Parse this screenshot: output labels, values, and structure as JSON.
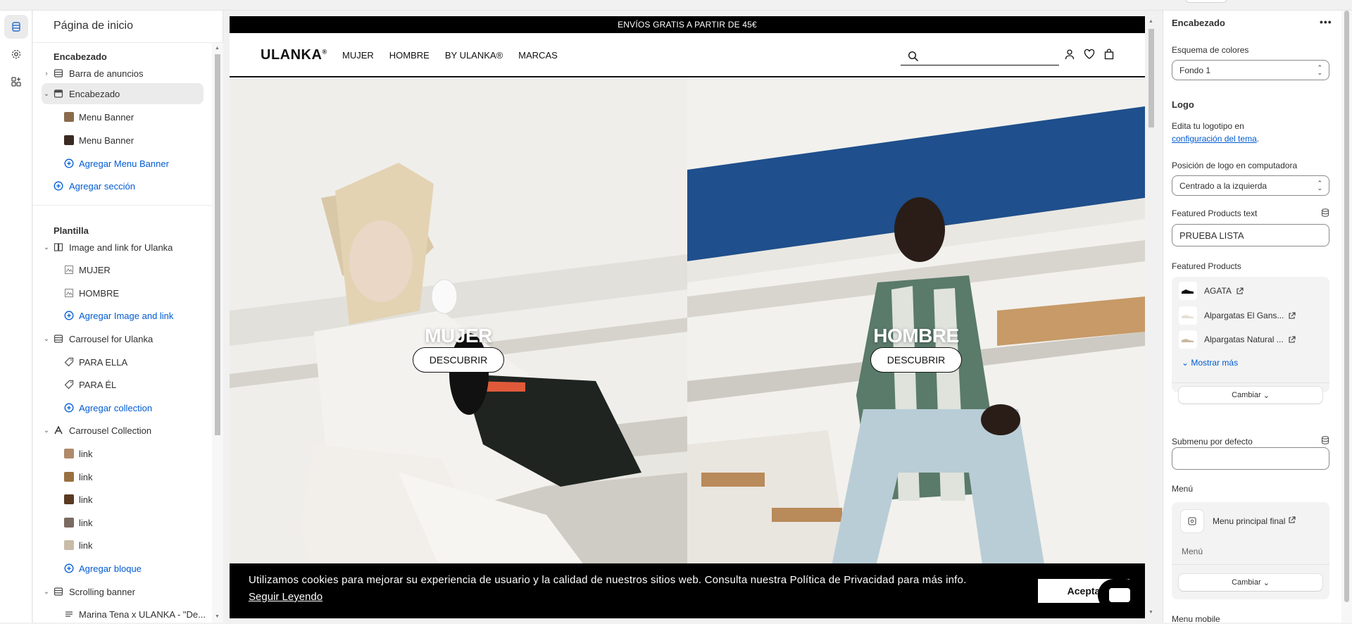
{
  "left_panel": {
    "title": "Página de inicio",
    "header_section": "Encabezado",
    "items": [
      {
        "label": "Barra de anuncios"
      },
      {
        "label": "Encabezado"
      },
      {
        "label": "Menu Banner"
      },
      {
        "label": "Menu Banner"
      },
      {
        "label": "Agregar Menu Banner"
      },
      {
        "label": "Agregar sección"
      }
    ],
    "template_section": "Plantilla",
    "template_items": [
      {
        "label": "Image and link for Ulanka"
      },
      {
        "label": "MUJER"
      },
      {
        "label": "HOMBRE"
      },
      {
        "label": "Agregar Image and link"
      },
      {
        "label": "Carrousel for Ulanka"
      },
      {
        "label": "PARA ELLA"
      },
      {
        "label": "PARA ÉL"
      },
      {
        "label": "Agregar collection"
      },
      {
        "label": "Carrousel Collection"
      },
      {
        "label": "link"
      },
      {
        "label": "link"
      },
      {
        "label": "link"
      },
      {
        "label": "link"
      },
      {
        "label": "link"
      },
      {
        "label": "Agregar bloque"
      },
      {
        "label": "Scrolling banner"
      },
      {
        "label": "Marina Tena x ULANKA - \"De..."
      }
    ]
  },
  "preview": {
    "announcement": "ENVÍOS GRATIS A PARTIR DE 45€",
    "logo": "ULANKA",
    "logo_mark": "®",
    "nav": [
      "MUJER",
      "HOMBRE",
      "BY ULANKA®",
      "MARCAS"
    ],
    "hero": [
      {
        "title": "MUJER",
        "button": "DESCUBRIR"
      },
      {
        "title": "HOMBRE",
        "button": "DESCUBRIR"
      }
    ],
    "cookie": {
      "message": "Utilizamos cookies para mejorar su experiencia de usuario y la calidad de nuestros sitios web. Consulta nuestra Política de Privacidad para más info.",
      "more_link": "Seguir Leyendo",
      "accept": "Acepta"
    }
  },
  "right_panel": {
    "title": "Encabezado",
    "more": "•••",
    "color_scheme_label": "Esquema de colores",
    "color_scheme_value": "Fondo 1",
    "logo_heading": "Logo",
    "logo_help_pre": "Edita tu logotipo en",
    "logo_help_link": "configuración del tema",
    "logo_help_post": ".",
    "logo_position_label": "Posición de logo en computadora",
    "logo_position_value": "Centrado a la izquierda",
    "featured_text_label": "Featured Products text",
    "featured_text_value": "PRUEBA LISTA",
    "featured_products_label": "Featured Products",
    "products": [
      "AGATA",
      "Alpargatas El Gans...",
      "Alpargatas Natural ..."
    ],
    "show_more": "Mostrar más",
    "change_button": "Cambiar",
    "submenu_label": "Submenu por defecto",
    "submenu_value": "",
    "menu_label": "Menú",
    "menu_name": "Menu principal final",
    "menu_sub": "Menú",
    "menu_change": "Cambiar",
    "menu_mobile_label": "Menu mobile"
  },
  "colors": {
    "accent_link": "#005bd3",
    "selected_row": "#ebebeb",
    "site_black": "#000000"
  }
}
